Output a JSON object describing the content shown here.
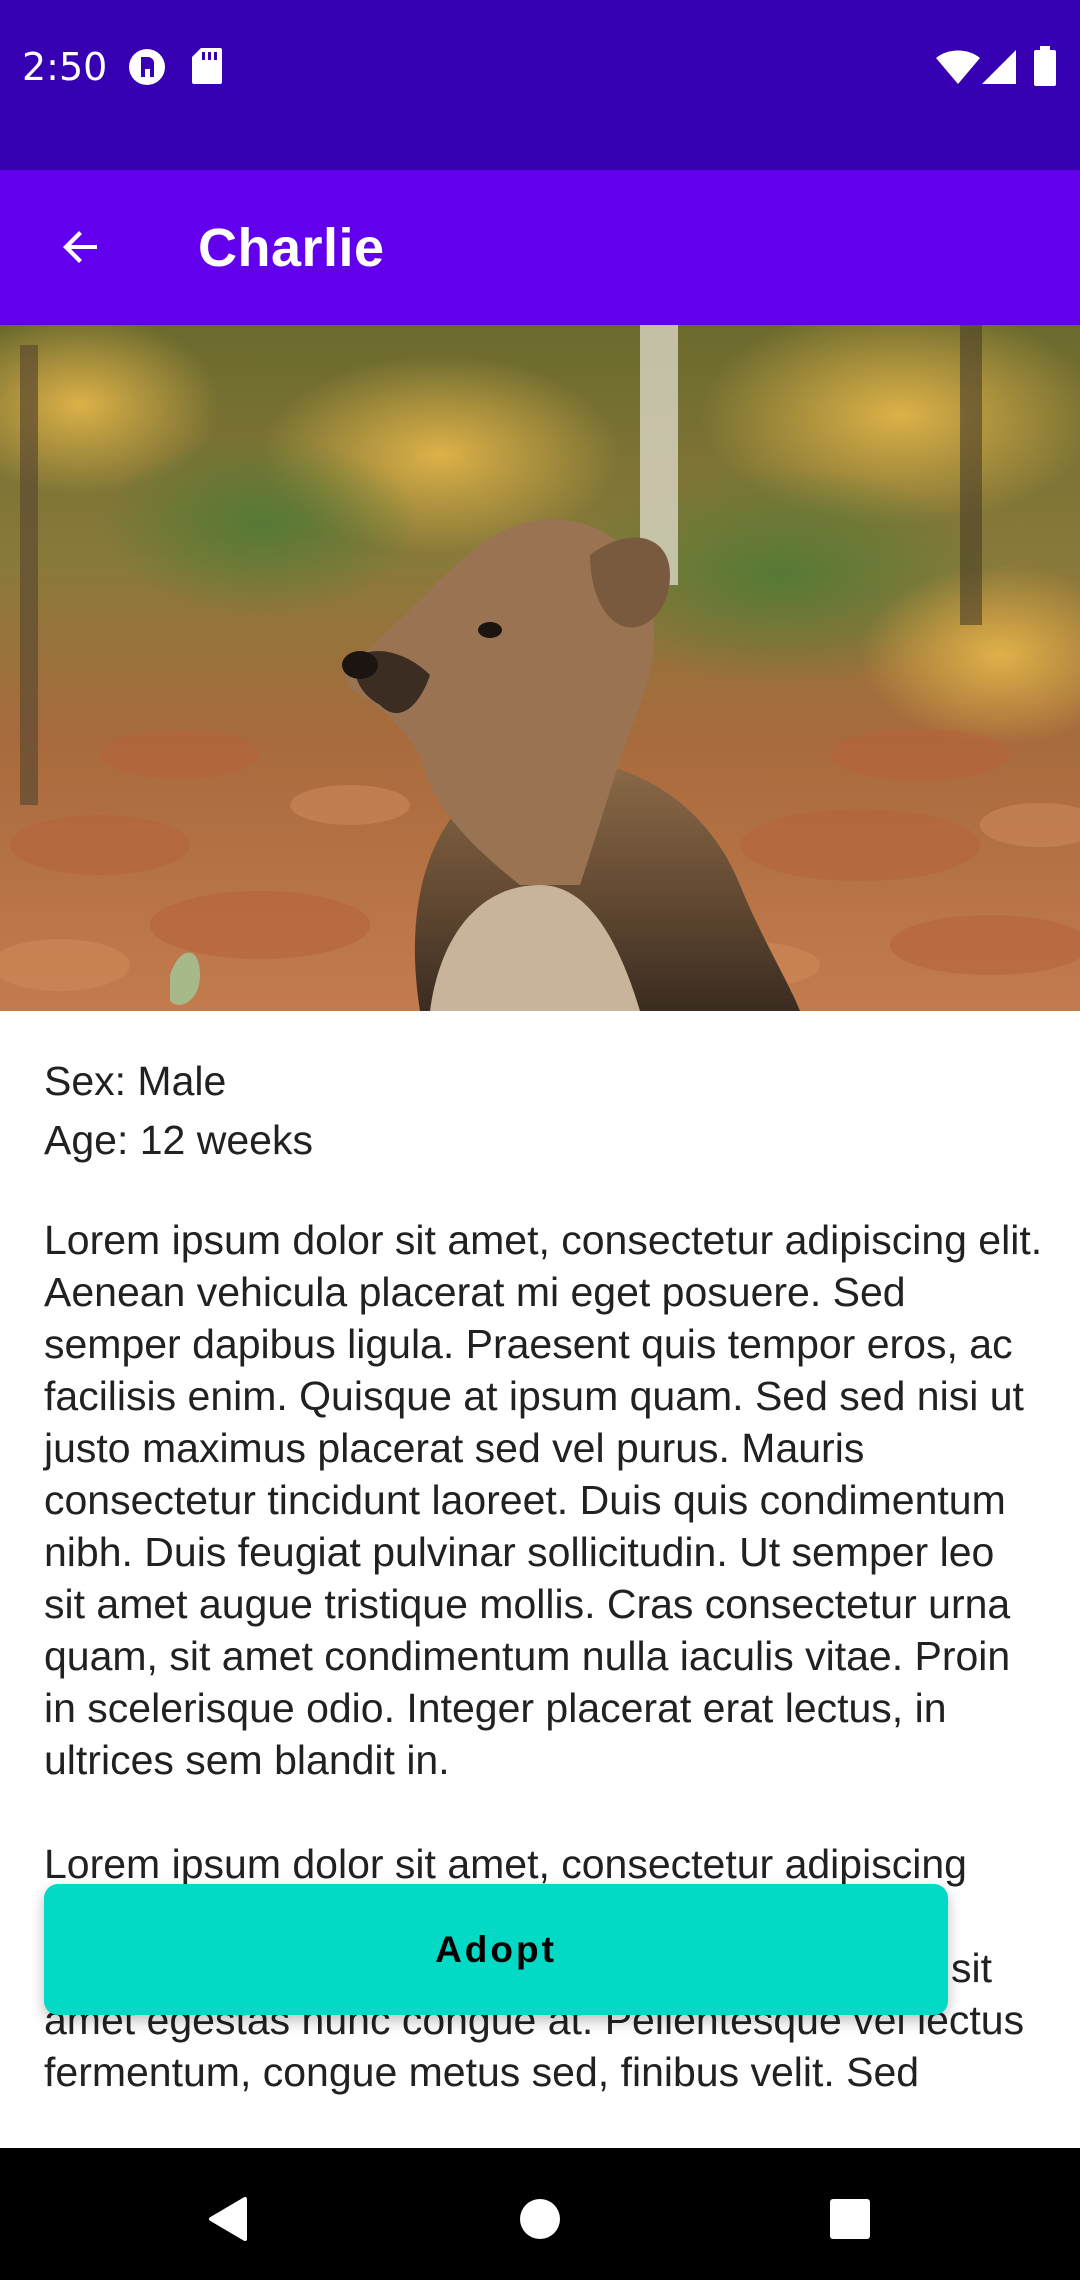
{
  "status_bar": {
    "time": "2:50",
    "icons_left": [
      "app-notification-icon",
      "sd-card-icon"
    ],
    "icons_right": [
      "wifi-icon",
      "cell-signal-icon",
      "battery-icon"
    ]
  },
  "app_bar": {
    "title": "Charlie",
    "back_icon": "arrow-back-icon"
  },
  "hero_image": {
    "subject": "puppy sitting in autumn leaves"
  },
  "details": {
    "sex": "Sex: Male",
    "age": "Age: 12 weeks",
    "description": "Lorem ipsum dolor sit amet, consectetur adipiscing elit. Aenean vehicula placerat mi eget posuere. Sed semper dapibus ligula. Praesent quis tempor eros, ac facilisis enim. Quisque at ipsum quam. Sed sed nisi ut justo maximus placerat sed vel purus. Mauris consectetur tincidunt laoreet. Duis quis condimentum nibh. Duis feugiat pulvinar sollicitudin. Ut semper leo sit amet augue tristique mollis. Cras consectetur urna quam, sit amet condimentum nulla iaculis vitae. Proin in scelerisque odio. Integer placerat erat lectus, in ultrices sem blandit in.",
    "description_continued": "Lorem ipsum dolor sit amet, consectetur adipiscing elite, Aenean quis congue finibus velit sed ornare. Vestibulum quis lacinia orci. Ut vestibulum ex dui, sit amet egestas nunc congue at. Pellentesque vel lectus fermentum, congue metus sed, finibus velit. Sed"
  },
  "actions": {
    "adopt_label": "Adopt"
  },
  "nav_bar": {
    "buttons": [
      "back-triangle-icon",
      "home-circle-icon",
      "recents-square-icon"
    ]
  },
  "colors": {
    "status_bar": "#3700b3",
    "app_bar": "#6200ee",
    "adopt_button": "#03dac5",
    "nav_bar": "#000000"
  }
}
